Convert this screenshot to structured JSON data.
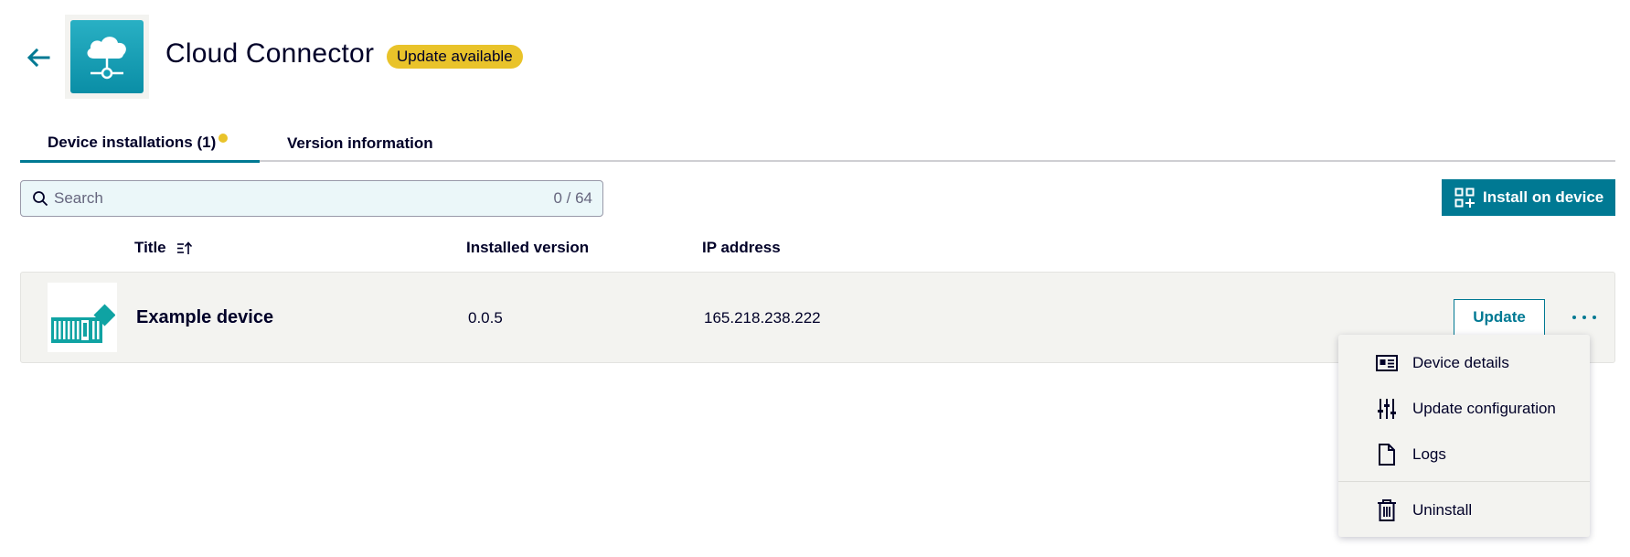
{
  "header": {
    "back_icon": "arrow-left-icon",
    "app_icon": "cloud-network-icon",
    "title": "Cloud Connector",
    "badge": "Update available",
    "badge_color": "#e9c32a"
  },
  "tabs": [
    {
      "label": "Device installations (1)",
      "active": true,
      "has_dot": true
    },
    {
      "label": "Version information",
      "active": false
    }
  ],
  "search": {
    "placeholder": "Search",
    "value": "",
    "count": "0 / 64"
  },
  "install_button": {
    "label": "Install on device",
    "icon": "add-apps-icon"
  },
  "table": {
    "columns": [
      {
        "label": "Title",
        "sortable": true,
        "sort_icon": "sort-ascending-icon"
      },
      {
        "label": "Installed version"
      },
      {
        "label": "IP address"
      }
    ],
    "rows": [
      {
        "thumbnail": "industrial-device-icon",
        "title": "Example device",
        "installed_version": "0.0.5",
        "ip_address": "165.218.238.222",
        "update_label": "Update",
        "more_icon": "more-horizontal-icon"
      }
    ]
  },
  "context_menu": {
    "items": [
      {
        "label": "Device details",
        "icon": "id-card-icon"
      },
      {
        "label": "Update configuration",
        "icon": "sliders-icon"
      },
      {
        "label": "Logs",
        "icon": "document-icon"
      },
      {
        "label": "Uninstall",
        "icon": "trash-icon"
      }
    ]
  },
  "colors": {
    "accent": "#007993",
    "text": "#000028",
    "row_background": "#f3f3f0"
  }
}
